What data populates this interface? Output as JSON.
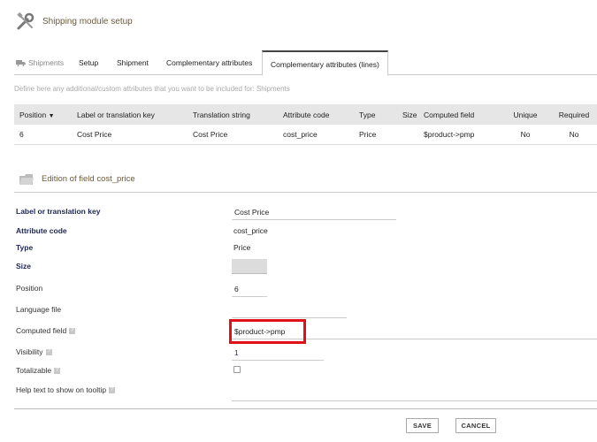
{
  "header": {
    "title": "Shipping module setup",
    "icon": "tools-icon"
  },
  "tabs": [
    {
      "label": "Shipments",
      "icon": "truck-icon"
    },
    {
      "label": "Setup"
    },
    {
      "label": "Shipment"
    },
    {
      "label": "Complementary attributes"
    },
    {
      "label": "Complementary attributes (lines)",
      "active": true
    }
  ],
  "define_text": "Define here any additional/custom attributes that you want to be included for: Shipments",
  "attributes_table": {
    "columns": [
      "Position",
      "Label or translation key",
      "Translation string",
      "Attribute code",
      "Type",
      "Size",
      "Computed field",
      "Unique",
      "Required"
    ],
    "rows": [
      [
        "6",
        "Cost Price",
        "Cost Price",
        "cost_price",
        "Price",
        "",
        "$product->pmp",
        "No",
        "No"
      ]
    ]
  },
  "edition": {
    "title": "Edition of field cost_price",
    "icon": "folder-icon"
  },
  "fields": {
    "label_key": {
      "label": "Label or translation key",
      "value": "Cost Price"
    },
    "attr_code": {
      "label": "Attribute code",
      "value": "cost_price"
    },
    "type": {
      "label": "Type",
      "value": "Price"
    },
    "size": {
      "label": "Size",
      "value": ""
    },
    "position": {
      "label": "Position",
      "value": "6"
    },
    "lang_file": {
      "label": "Language file",
      "value": ""
    },
    "computed": {
      "label": "Computed field",
      "value": "$product->pmp"
    },
    "visibility": {
      "label": "Visibility",
      "value": "1"
    },
    "totalizable": {
      "label": "Totalizable",
      "checked": false
    },
    "help_text": {
      "label": "Help text to show on tooltip",
      "value": ""
    }
  },
  "buttons": {
    "save": "SAVE",
    "cancel": "CANCEL"
  },
  "colors": {
    "highlight": "#e0101a",
    "header_text": "#6b5a3a",
    "strong_label": "#1c2550"
  }
}
